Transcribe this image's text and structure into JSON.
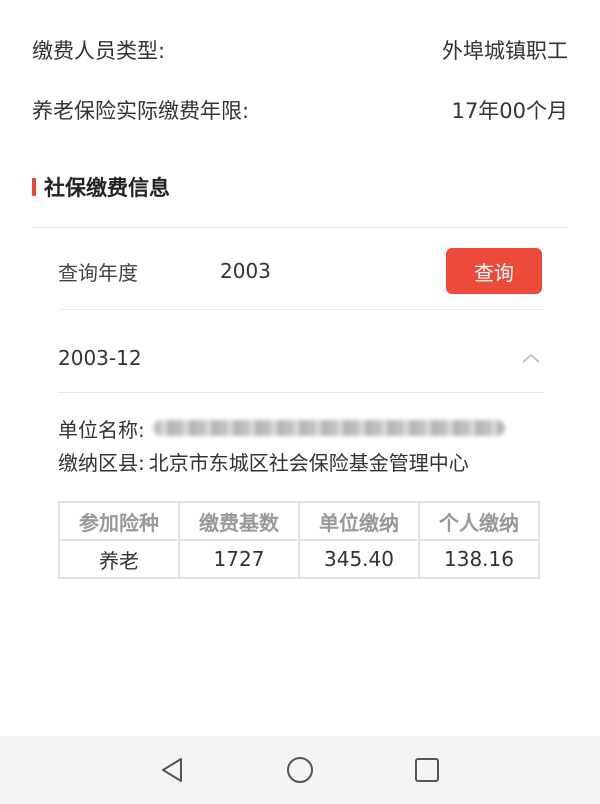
{
  "summary": {
    "payer_type_label": "缴费人员类型:",
    "payer_type_value": "外埠城镇职工",
    "pension_years_label": "养老保险实际缴费年限:",
    "pension_years_value": "17年00个月"
  },
  "section": {
    "title": "社保缴费信息"
  },
  "query": {
    "label": "查询年度",
    "year": "2003",
    "button": "查询"
  },
  "record": {
    "month": "2003-12",
    "employer_label": "单位名称:",
    "district_label": "缴纳区县:",
    "district_value": "北京市东城区社会保险基金管理中心"
  },
  "table": {
    "headers": [
      "参加险种",
      "缴费基数",
      "单位缴纳",
      "个人缴纳"
    ],
    "rows": [
      [
        "养老",
        "1727",
        "345.40",
        "138.16"
      ]
    ]
  },
  "colors": {
    "accent": "#ec4a3b",
    "section_bar": "#e8443a"
  },
  "icons": {
    "collapse": "chevron-up-icon",
    "back": "triangle-back-icon",
    "home": "circle-home-icon",
    "recents": "square-recents-icon"
  }
}
